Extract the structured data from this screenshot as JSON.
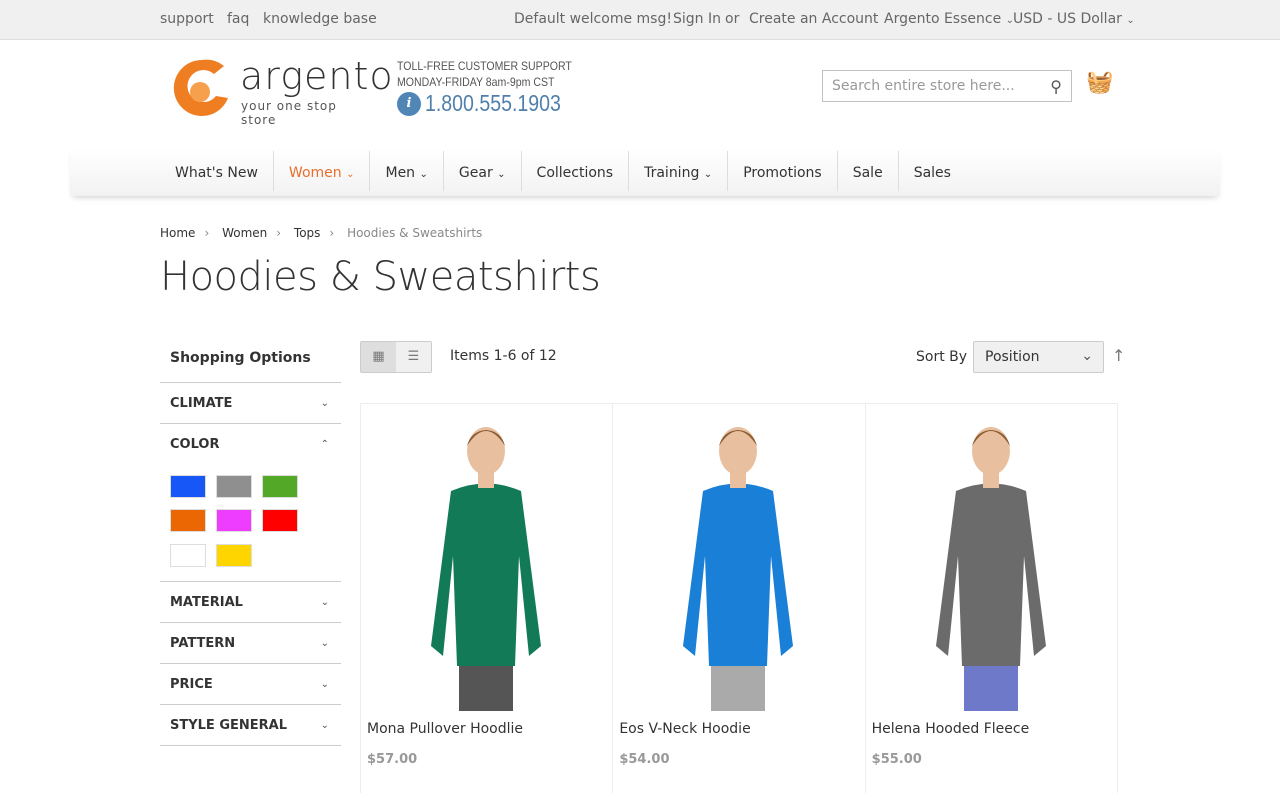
{
  "topbar": {
    "links": [
      "support",
      "faq",
      "knowledge base"
    ],
    "welcome": "Default welcome msg!",
    "sign_in": "Sign In",
    "or": "or",
    "create_account": "Create an Account",
    "store": "Argento Essence",
    "currency": "USD - US Dollar"
  },
  "header": {
    "logo_text": "argento",
    "logo_tagline": "your one stop store",
    "support_line1": "TOLL-FREE CUSTOMER SUPPORT",
    "support_line2": "MONDAY-FRIDAY 8am-9pm CST",
    "phone": "1.800.555.1903",
    "search_placeholder": "Search entire store here..."
  },
  "nav": {
    "items": [
      "What's New",
      "Women",
      "Men",
      "Gear",
      "Collections",
      "Training",
      "Promotions",
      "Sale",
      "Sales"
    ],
    "active": "Women"
  },
  "breadcrumbs": [
    "Home",
    "Women",
    "Tops",
    "Hoodies & Sweatshirts"
  ],
  "page_title": "Hoodies & Sweatshirts",
  "sidebar": {
    "title": "Shopping Options",
    "filters": [
      "CLIMATE",
      "COLOR",
      "MATERIAL",
      "PATTERN",
      "PRICE",
      "STYLE GENERAL"
    ],
    "colors": [
      "#1857f7",
      "#8f8f8f",
      "#53a828",
      "#eb6703",
      "#ef3dff",
      "#ff0000",
      "#ffffff",
      "#ffd500"
    ]
  },
  "toolbar": {
    "items": "Items 1-6 of 12",
    "sort_label": "Sort By",
    "sort_value": "Position"
  },
  "products": [
    {
      "name": "Mona Pullover Hoodlie",
      "price": "$57.00",
      "color": "#137a58",
      "pants": "#555555"
    },
    {
      "name": "Eos V-Neck Hoodie",
      "price": "$54.00",
      "color": "#1a7fd6",
      "pants": "#aaaaaa"
    },
    {
      "name": "Helena Hooded Fleece",
      "price": "$55.00",
      "color": "#6b6b6b",
      "pants": "#6f79c9"
    }
  ]
}
